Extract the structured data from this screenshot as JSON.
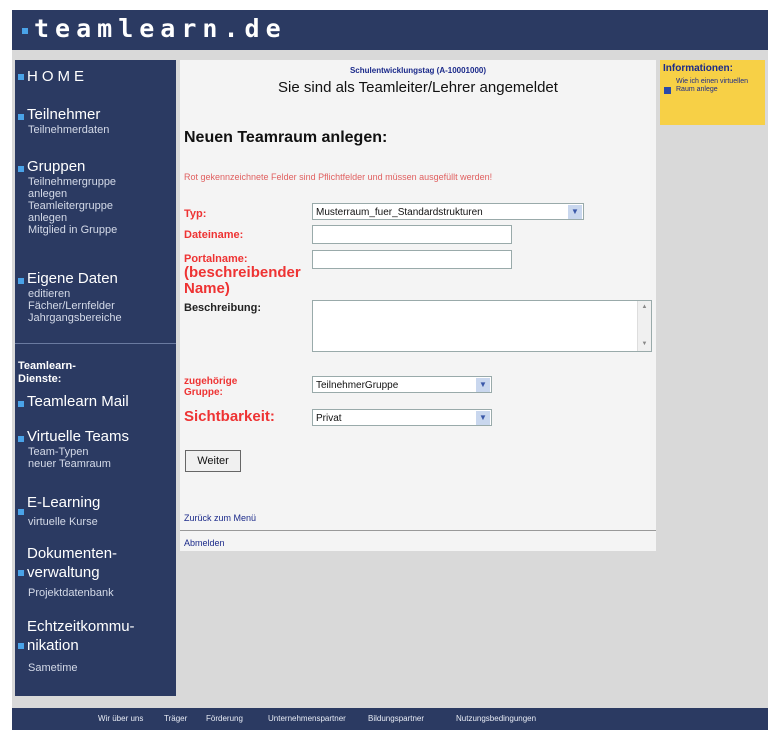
{
  "logo": "teamlearn.de",
  "sidebar": {
    "home": "HOME",
    "teilnehmer": {
      "label": "Teilnehmer",
      "subs": [
        "Teilnehmerdaten"
      ]
    },
    "gruppen": {
      "label": "Gruppen",
      "subs": [
        "Teilnehmergruppe",
        "anlegen",
        "Teamleitergruppe",
        "anlegen",
        "Mitglied in Gruppe"
      ]
    },
    "eigene": {
      "label": "Eigene Daten",
      "subs": [
        "editieren",
        "Fächer/Lernfelder",
        "Jahrgangsbereiche"
      ]
    },
    "dienste": [
      "Teamlearn-",
      "Dienste:"
    ],
    "mail": {
      "label": "Teamlearn Mail"
    },
    "virtuelle": {
      "label": "Virtuelle Teams",
      "subs": [
        "Team-Typen",
        "neuer Teamraum"
      ]
    },
    "elearning": {
      "label": "E-Learning",
      "subs": [
        "virtuelle Kurse"
      ]
    },
    "dokumente": {
      "label": [
        "Dokumenten-",
        "verwaltung"
      ],
      "subs": [
        "Projektdatenbank"
      ]
    },
    "echtzeit": {
      "label": [
        "Echtzeitkommu-",
        "nikation"
      ],
      "subs": [
        "Sametime"
      ]
    }
  },
  "content": {
    "course": "Schulentwicklungstag (A-10001000)",
    "logged_in": "Sie sind als Teamleiter/Lehrer angemeldet",
    "heading": "Neuen Teamraum anlegen:",
    "required_note": "Rot gekennzeichnete Felder sind Pflichtfelder und müssen ausgefüllt werden!",
    "form": {
      "typ": {
        "label": "Typ:",
        "value": "Musterraum_fuer_Standardstrukturen"
      },
      "dateiname": {
        "label": "Dateiname:",
        "value": ""
      },
      "portalname": {
        "label": [
          "Portalname:",
          "(beschreibender",
          "Name)"
        ],
        "value": ""
      },
      "beschreibung": {
        "label": "Beschreibung:",
        "value": ""
      },
      "gruppe": {
        "label": [
          "zugehörige",
          "Gruppe:"
        ],
        "value": "TeilnehmerGruppe"
      },
      "sichtbarkeit": {
        "label": "Sichtbarkeit:",
        "value": "Privat"
      }
    },
    "weiter": "Weiter",
    "zurueck": "Zurück zum Menü",
    "abmelden": "Abmelden"
  },
  "info": {
    "title": "Informationen:",
    "link": "Wie ich einen virtuellen Raum anlege"
  },
  "footer": [
    "Wir über uns",
    "Träger",
    "Förderung",
    "Unternehmenspartner",
    "Bildungspartner",
    "Nutzungsbedingungen"
  ],
  "colors": {
    "navy": "#2b3a62",
    "accent": "#4aa3e8",
    "required": "#e33333",
    "info_bg": "#f7d046"
  }
}
